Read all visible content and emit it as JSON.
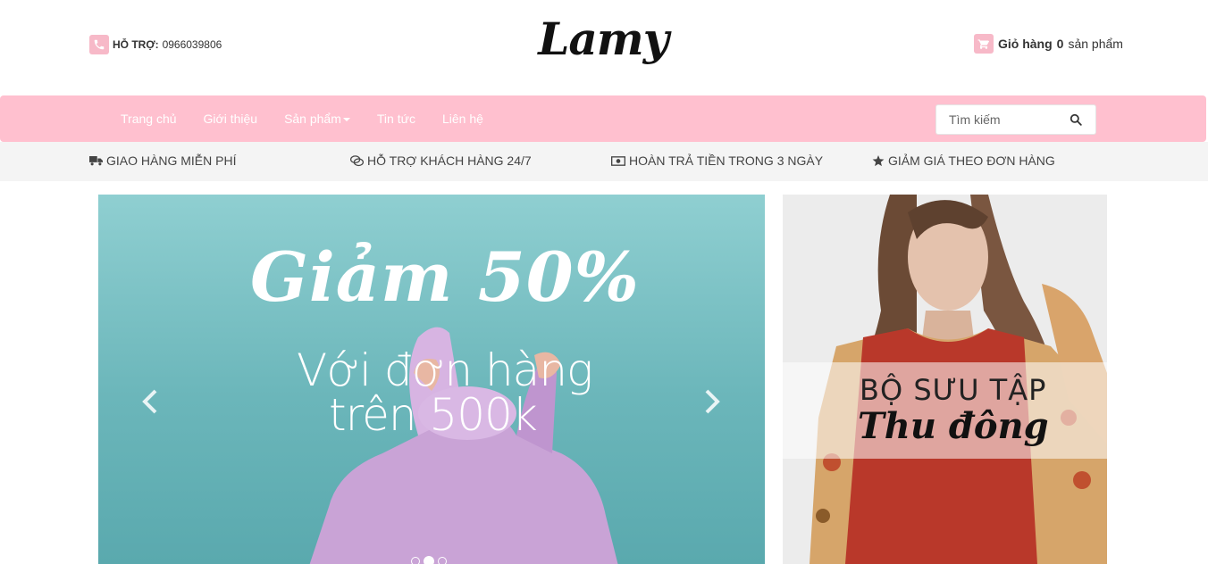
{
  "header": {
    "support_label": "HỖ TRỢ:",
    "support_phone": "0966039806",
    "logo": "Lamy",
    "cart_label": "Giỏ hàng",
    "cart_count": "0",
    "cart_suffix": "sản phẩm"
  },
  "nav": {
    "items": [
      "Trang chủ",
      "Giới thiệu",
      "Sản phẩm",
      "Tin tức",
      "Liên hệ"
    ],
    "search_placeholder": "Tìm kiếm"
  },
  "features": [
    {
      "icon": "truck-icon",
      "label": "GIAO HÀNG MIỄN PHÍ"
    },
    {
      "icon": "chat-icon",
      "label": "HỖ TRỢ KHÁCH HÀNG 24/7"
    },
    {
      "icon": "money-icon",
      "label": "HOÀN TRẢ TIỀN TRONG 3 NGÀY"
    },
    {
      "icon": "star-icon",
      "label": "GIẢM GIÁ THEO ĐƠN HÀNG"
    }
  ],
  "slider": {
    "title": "Giảm 50%",
    "line1": "Với đơn hàng",
    "line2": "trên 500k",
    "slide_count": 3,
    "active_slide": 2
  },
  "banner": {
    "line1": "BỘ SƯU TẬP",
    "line2": "Thu đông"
  },
  "colors": {
    "brand_pink": "#ffc0cf",
    "icon_pink": "#f7b9c8",
    "slide_teal": "#77bfc3",
    "sweater_lilac": "#c9a3d6"
  }
}
